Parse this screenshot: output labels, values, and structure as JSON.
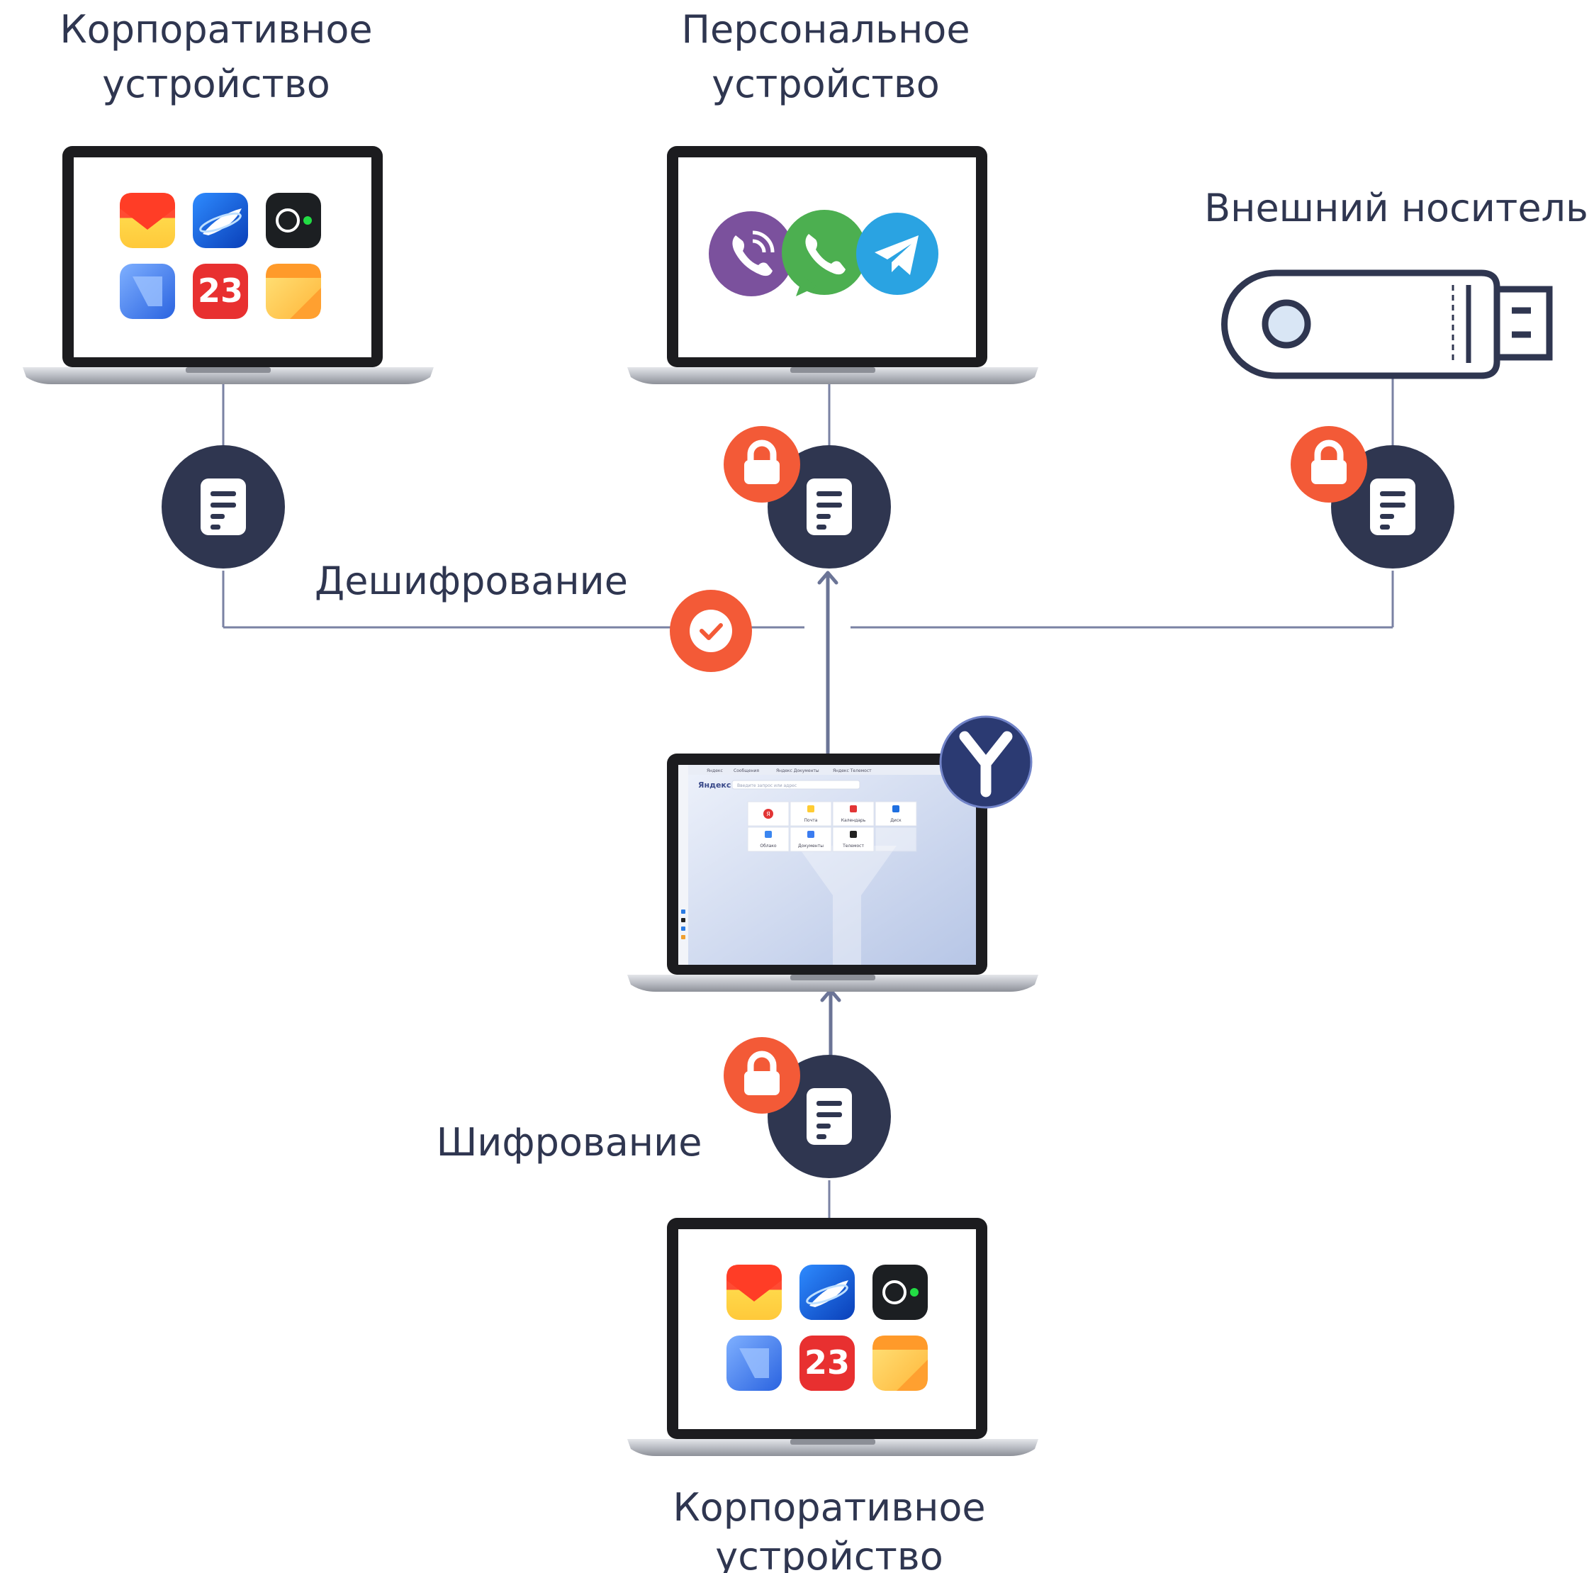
{
  "labels": {
    "corp_top_line1": "Корпоративное",
    "corp_top_line2": "устройство",
    "personal_line1": "Персональное",
    "personal_line2": "устройство",
    "external": "Внешний носитель",
    "decrypt": "Дешифрование",
    "encrypt": "Шифрование",
    "corp_bottom_line1": "Корпоративное",
    "corp_bottom_line2": "устройство"
  },
  "corp_apps": {
    "calendar_day": "23"
  },
  "browser": {
    "brand": "Яндекс",
    "search_placeholder": "Введите запрос или адрес",
    "tabs": [
      "Яндекс",
      "Сообщения",
      "Яндекс Документы",
      "Яндекс Телемост"
    ],
    "tiles": [
      {
        "label": "Почта",
        "color": "#ffcc33"
      },
      {
        "label": "Календарь",
        "color": "#e23535"
      },
      {
        "label": "Диск",
        "color": "#1f6fe0"
      },
      {
        "label": "Облако",
        "color": "#3b86f0"
      },
      {
        "label": "Документы",
        "color": "#3b7cf0"
      },
      {
        "label": "Телемост",
        "color": "#222222"
      }
    ],
    "first_tile_letter": "Я"
  },
  "colors": {
    "dark_navy": "#2f3650",
    "accent_orange": "#f35a37",
    "connector": "#7a82a3",
    "arrow": "#6b7496",
    "usb_outline": "#2f3650"
  },
  "icons": [
    "document-icon",
    "lock-icon",
    "check-icon",
    "yandex-browser-logo",
    "usb-drive-icon",
    "viber-icon",
    "whatsapp-icon",
    "telegram-icon"
  ]
}
